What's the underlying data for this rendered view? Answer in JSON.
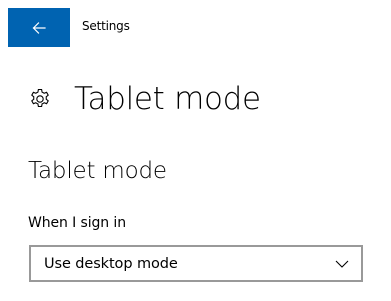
{
  "titlebar": {
    "back_icon": "arrow-left-icon",
    "title": "Settings",
    "accent_color": "#0063b1"
  },
  "header": {
    "icon": "gear-icon",
    "title": "Tablet mode"
  },
  "section": {
    "title": "Tablet mode"
  },
  "sign_in_setting": {
    "label": "When I sign in",
    "selected_value": "Use desktop mode",
    "chevron_icon": "chevron-down-icon"
  }
}
